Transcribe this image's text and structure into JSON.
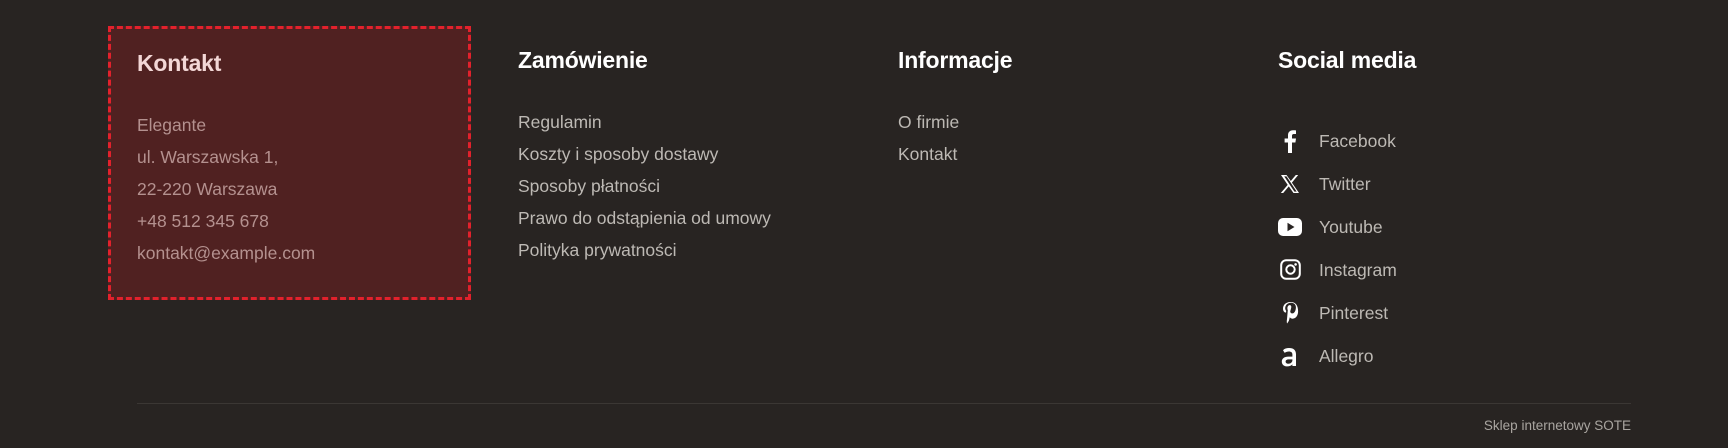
{
  "columns": {
    "contact": {
      "title": "Kontakt",
      "lines": [
        "Elegante",
        "ul. Warszawska 1,",
        "22-220 Warszawa",
        "+48 512 345 678",
        "kontakt@example.com"
      ]
    },
    "order": {
      "title": "Zamówienie",
      "links": [
        "Regulamin",
        "Koszty i sposoby dostawy",
        "Sposoby płatności",
        "Prawo do odstąpienia od umowy",
        "Polityka prywatności"
      ]
    },
    "info": {
      "title": "Informacje",
      "links": [
        "O firmie",
        "Kontakt"
      ]
    },
    "social": {
      "title": "Social media",
      "links": [
        {
          "label": "Facebook",
          "icon": "facebook-icon"
        },
        {
          "label": "Twitter",
          "icon": "x-twitter-icon"
        },
        {
          "label": "Youtube",
          "icon": "youtube-icon"
        },
        {
          "label": "Instagram",
          "icon": "instagram-icon"
        },
        {
          "label": "Pinterest",
          "icon": "pinterest-icon"
        },
        {
          "label": "Allegro",
          "icon": "allegro-icon"
        }
      ]
    }
  },
  "footer": {
    "credit": "Sklep internetowy SOTE"
  },
  "colors": {
    "background": "#282422",
    "highlight_fill": "#502121",
    "highlight_border": "#e2212c",
    "link_text": "#bdb9b4",
    "heading_text": "#ffffff"
  }
}
